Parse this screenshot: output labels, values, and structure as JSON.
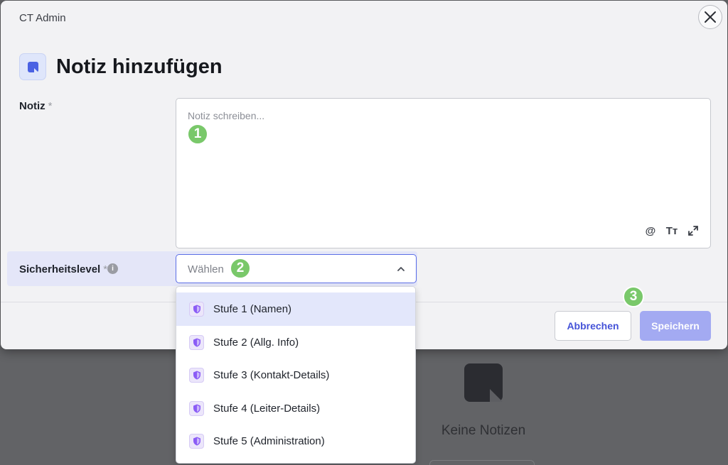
{
  "header": {
    "app_name": "CT Admin"
  },
  "title": "Notiz hinzufügen",
  "note_field": {
    "label": "Notiz",
    "required_mark": "*",
    "placeholder": "Notiz schreiben..."
  },
  "editor_tools": {
    "mention": "@",
    "format": "Tт"
  },
  "security_field": {
    "label": "Sicherheitslevel",
    "required_mark": "*",
    "info": "i",
    "placeholder": "Wählen"
  },
  "dropdown": {
    "options": [
      {
        "label": "Stufe 1 (Namen)",
        "selected": true
      },
      {
        "label": "Stufe 2 (Allg. Info)",
        "selected": false
      },
      {
        "label": "Stufe 3 (Kontakt-Details)",
        "selected": false
      },
      {
        "label": "Stufe 4 (Leiter-Details)",
        "selected": false
      },
      {
        "label": "Stufe 5 (Administration)",
        "selected": false
      }
    ]
  },
  "buttons": {
    "cancel": "Abbrechen",
    "save": "Speichern"
  },
  "badges": [
    "1",
    "2",
    "3"
  ],
  "background": {
    "empty_label": "Keine Notizen"
  },
  "colors": {
    "accent": "#4553d8",
    "save_disabled": "#a3aaf2",
    "badge": "#79c86a",
    "shield": "#8b5cf6"
  }
}
